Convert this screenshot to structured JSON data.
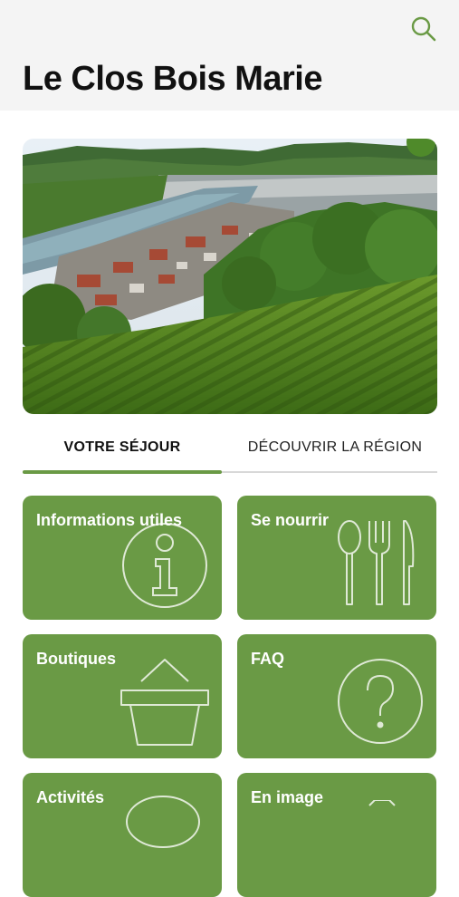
{
  "header": {
    "title": "Le Clos Bois Marie",
    "search_icon": "search-icon"
  },
  "hero": {
    "image": "vineyard-landscape-photo"
  },
  "tabs": [
    {
      "label": "VOTRE SÉJOUR",
      "active": true
    },
    {
      "label": "DÉCOUVRIR LA RÉGION",
      "active": false
    }
  ],
  "tiles": [
    {
      "label": "Informations utiles",
      "icon": "info-icon"
    },
    {
      "label": "Se nourrir",
      "icon": "cutlery-icon"
    },
    {
      "label": "Boutiques",
      "icon": "basket-icon"
    },
    {
      "label": "FAQ",
      "icon": "question-icon"
    },
    {
      "label": "Activités",
      "icon": "activity-icon"
    },
    {
      "label": "En image",
      "icon": "camera-icon"
    }
  ],
  "colors": {
    "accent": "#6a9a45",
    "header_bg": "#f4f4f4",
    "tile_text": "#ffffff"
  }
}
